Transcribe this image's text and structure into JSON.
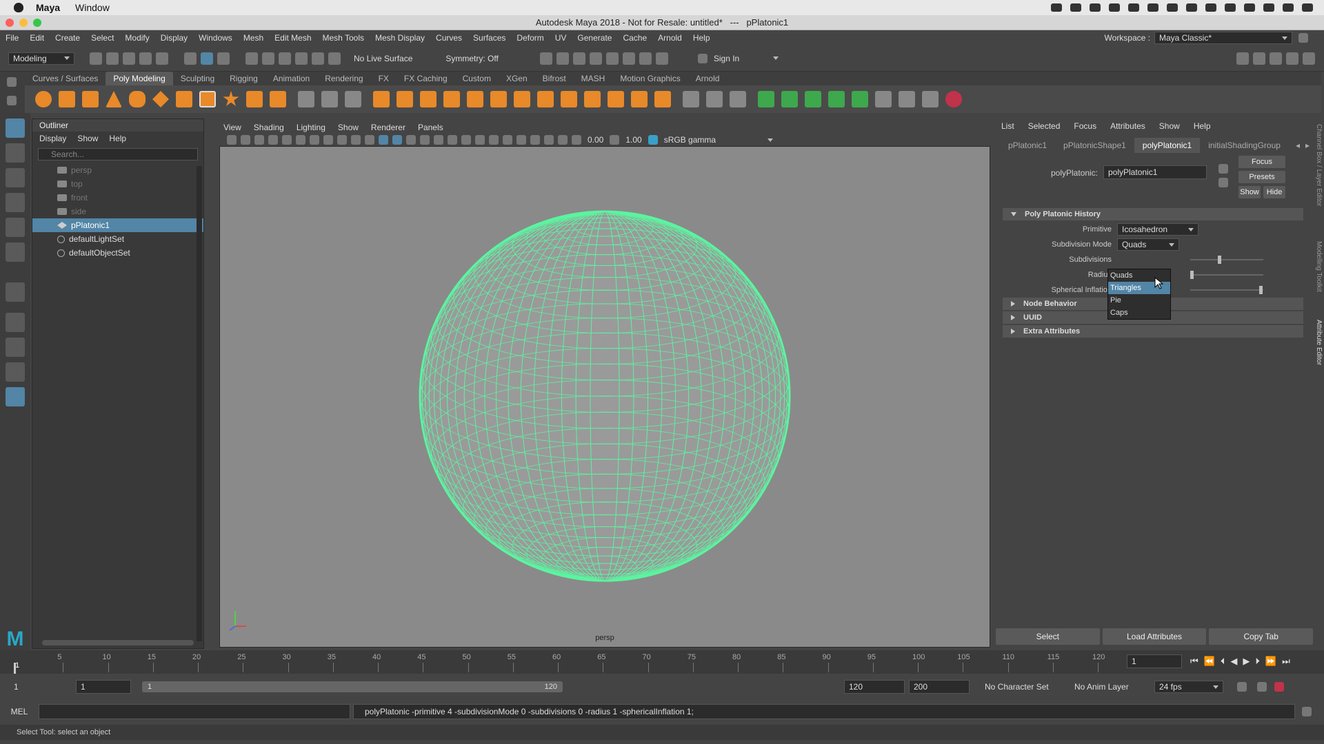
{
  "mac_menu": {
    "app": "Maya",
    "window": "Window"
  },
  "title": "Autodesk Maya 2018 - Not for Resale: untitled*   ---   pPlatonic1",
  "main_menu": [
    "File",
    "Edit",
    "Create",
    "Select",
    "Modify",
    "Display",
    "Windows",
    "Mesh",
    "Edit Mesh",
    "Mesh Tools",
    "Mesh Display",
    "Curves",
    "Surfaces",
    "Deform",
    "UV",
    "Generate",
    "Cache",
    "Arnold",
    "Help"
  ],
  "workspace": {
    "label": "Workspace :",
    "value": "Maya Classic*"
  },
  "status_line": {
    "mode": "Modeling",
    "live_surface": "No Live Surface",
    "symmetry": "Symmetry: Off",
    "sign_in": "Sign In"
  },
  "shelf_tabs": [
    "Curves / Surfaces",
    "Poly Modeling",
    "Sculpting",
    "Rigging",
    "Animation",
    "Rendering",
    "FX",
    "FX Caching",
    "Custom",
    "XGen",
    "Bifrost",
    "MASH",
    "Motion Graphics",
    "Arnold"
  ],
  "shelf_active": "Poly Modeling",
  "outliner": {
    "title": "Outliner",
    "menu": [
      "Display",
      "Show",
      "Help"
    ],
    "search_placeholder": "Search...",
    "items": [
      {
        "label": "persp",
        "dim": true,
        "kind": "cam"
      },
      {
        "label": "top",
        "dim": true,
        "kind": "cam"
      },
      {
        "label": "front",
        "dim": true,
        "kind": "cam"
      },
      {
        "label": "side",
        "dim": true,
        "kind": "cam"
      },
      {
        "label": "pPlatonic1",
        "selected": true,
        "kind": "mesh"
      },
      {
        "label": "defaultLightSet",
        "kind": "set"
      },
      {
        "label": "defaultObjectSet",
        "kind": "set"
      }
    ]
  },
  "viewport": {
    "menu": [
      "View",
      "Shading",
      "Lighting",
      "Show",
      "Renderer",
      "Panels"
    ],
    "exposure": "0.00",
    "gamma": "1.00",
    "color_space": "sRGB gamma",
    "camera_label": "persp",
    "wire_color": "#5cf5a0"
  },
  "attribute_editor": {
    "menu": [
      "List",
      "Selected",
      "Focus",
      "Attributes",
      "Show",
      "Help"
    ],
    "tabs": [
      "pPlatonic1",
      "pPlatonicShape1",
      "polyPlatonic1",
      "initialShadingGroup"
    ],
    "active_tab": "polyPlatonic1",
    "node_label": "polyPlatonic:",
    "node_value": "polyPlatonic1",
    "buttons": {
      "focus": "Focus",
      "presets": "Presets",
      "show": "Show",
      "hide": "Hide"
    },
    "section_history": "Poly Platonic History",
    "attrs": {
      "primitive_label": "Primitive",
      "primitive_value": "Icosahedron",
      "subdivision_mode_label": "Subdivision Mode",
      "subdivision_mode_value": "Quads",
      "subdivisions_label": "Subdivisions",
      "radius_label": "Radius",
      "spherical_label": "Spherical Inflation"
    },
    "dropdown_options": [
      "Quads",
      "Triangles",
      "Pie",
      "Caps"
    ],
    "dropdown_highlight": "Triangles",
    "sections": [
      "Node Behavior",
      "UUID",
      "Extra Attributes"
    ],
    "bottom_buttons": [
      "Select",
      "Load Attributes",
      "Copy Tab"
    ]
  },
  "right_vertical_tabs": [
    "Channel Box / Layer Editor",
    "Modelling Toolkit",
    "Attribute Editor"
  ],
  "timeline": {
    "ticks": [
      "5",
      "10",
      "15",
      "20",
      "25",
      "30",
      "35",
      "40",
      "45",
      "50",
      "55",
      "60",
      "65",
      "70",
      "75",
      "80",
      "85",
      "90",
      "95",
      "100",
      "105",
      "110",
      "115",
      "120"
    ],
    "current_frame_left": "1",
    "current_frame": "1"
  },
  "range": {
    "start": "1",
    "playback_start": "1",
    "slider_start": "1",
    "slider_end": "120",
    "playback_end": "120",
    "end": "200",
    "character_set": "No Character Set",
    "anim_layer": "No Anim Layer",
    "fps": "24 fps"
  },
  "command": {
    "lang": "MEL",
    "output": "polyPlatonic -primitive 4 -subdivisionMode 0 -subdivisions 0 -radius 1 -sphericalInflation 1;"
  },
  "help_line": "Select Tool: select an object",
  "colors": {
    "selection": "#5285a6",
    "viewport_bg": "#8a8a8a",
    "wireframe": "#5cf5a0"
  }
}
